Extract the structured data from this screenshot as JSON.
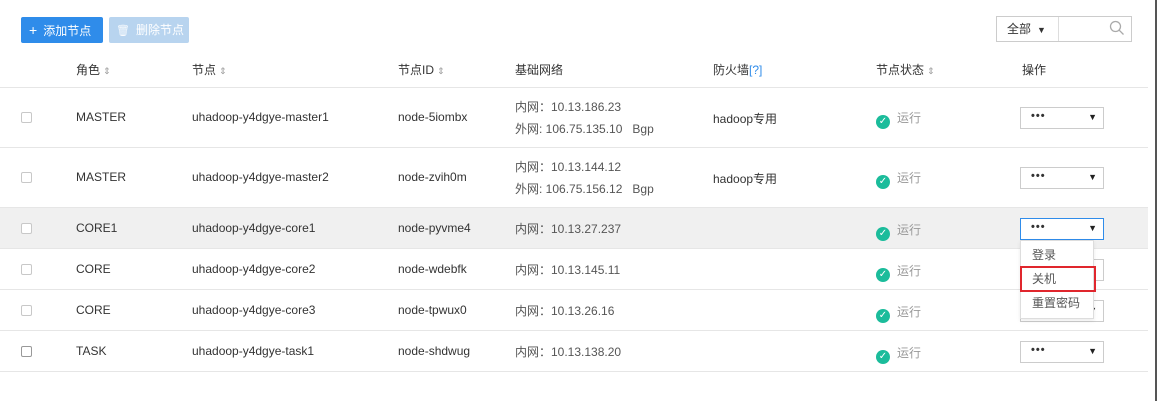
{
  "toolbar": {
    "add_label": "添加节点",
    "delete_label": "删除节点",
    "filter_value": "全部",
    "search_placeholder": ""
  },
  "columns": {
    "role": "角色",
    "node": "节点",
    "node_id": "节点ID",
    "network": "基础网络",
    "firewall": "防火墙",
    "firewall_help": "[?]",
    "status": "节点状态",
    "actions": "操作"
  },
  "rows": [
    {
      "role": "MASTER",
      "node": "uhadoop-y4dgye-master1",
      "node_id": "node-5iombx",
      "inner": "内网：10.13.186.23",
      "outer": "外网: 106.75.135.10",
      "outer_type": "Bgp",
      "firewall": "hadoop专用",
      "status": "运行",
      "action": "•••"
    },
    {
      "role": "MASTER",
      "node": "uhadoop-y4dgye-master2",
      "node_id": "node-zvih0m",
      "inner": "内网：10.13.144.12",
      "outer": "外网: 106.75.156.12",
      "outer_type": "Bgp",
      "firewall": "hadoop专用",
      "status": "运行",
      "action": "•••"
    },
    {
      "role": "CORE1",
      "node": "uhadoop-y4dgye-core1",
      "node_id": "node-pyvme4",
      "inner": "内网：10.13.27.237",
      "status": "运行",
      "action": "•••"
    },
    {
      "role": "CORE",
      "node": "uhadoop-y4dgye-core2",
      "node_id": "node-wdebfk",
      "inner": "内网：10.13.145.11",
      "status": "运行",
      "action": "•••"
    },
    {
      "role": "CORE",
      "node": "uhadoop-y4dgye-core3",
      "node_id": "node-tpwux0",
      "inner": "内网：10.13.26.16",
      "status": "运行",
      "action": "•••"
    },
    {
      "role": "TASK",
      "node": "uhadoop-y4dgye-task1",
      "node_id": "node-shdwug",
      "inner": "内网：10.13.138.20",
      "status": "运行",
      "action": "•••"
    }
  ],
  "dropdown_menu": {
    "items": [
      "登录",
      "关机",
      "重置密码"
    ],
    "highlighted": "关机"
  },
  "colors": {
    "primary": "#2f8cea",
    "disabled": "#b8d4ef",
    "status_ok": "#1bbc9b",
    "highlight_border": "#e0262d"
  }
}
